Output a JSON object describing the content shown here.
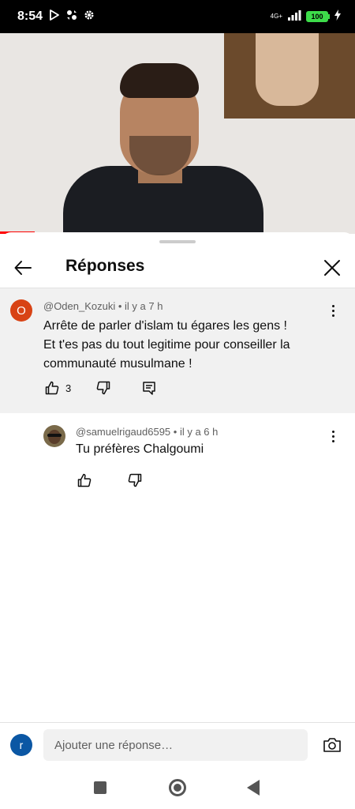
{
  "status_bar": {
    "time": "8:54",
    "network": "4G+",
    "battery": "100"
  },
  "panel": {
    "title": "Réponses"
  },
  "comment": {
    "avatar_letter": "O",
    "author": "@Oden_Kozuki",
    "age": "il y a 7 h",
    "text_lines": [
      "Arrête de parler d'islam tu égares les gens !",
      "Et t'es pas du tout legitime pour conseiller la",
      "communauté musulmane !"
    ],
    "likes": "3"
  },
  "reply": {
    "author": "@samuelrigaud6595",
    "age": "il y a 6 h",
    "text": "Tu préfères Chalgoumi"
  },
  "reply_bar": {
    "user_avatar_letter": "r",
    "placeholder": "Ajouter une réponse…"
  },
  "colors": {
    "progress": "#ff0000",
    "avatar_o": "#d84315",
    "user_avatar": "#0b57a4",
    "battery": "#3ddc4a"
  },
  "icons": [
    "play-store-icon",
    "pinwheel-icon",
    "settings-gear-icon",
    "signal-icon",
    "battery-icon",
    "charging-bolt-icon",
    "back-arrow-icon",
    "close-icon",
    "more-vert-icon",
    "thumb-up-icon",
    "thumb-down-icon",
    "reply-comment-icon",
    "camera-icon"
  ]
}
